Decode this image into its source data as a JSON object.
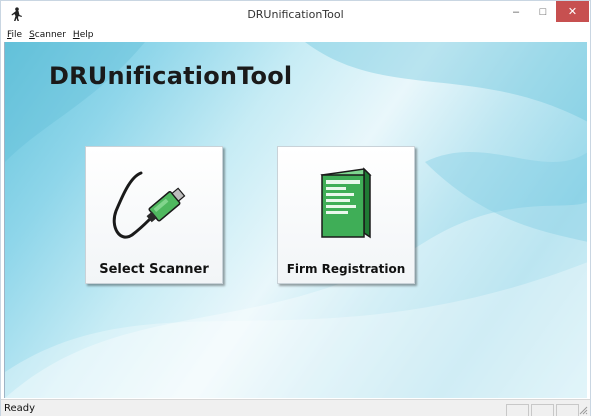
{
  "window": {
    "title": "DRUnificationTool",
    "app_icon": "app-figure-icon",
    "controls": {
      "minimize": "–",
      "maximize": "□",
      "close": "✕"
    }
  },
  "menu": {
    "items": [
      {
        "label": "File",
        "mnemonic": "F",
        "rest": "ile"
      },
      {
        "label": "Scanner",
        "mnemonic": "S",
        "rest": "canner"
      },
      {
        "label": "Help",
        "mnemonic": "H",
        "rest": "elp"
      }
    ]
  },
  "main": {
    "heading": "DRUnificationTool",
    "tiles": [
      {
        "label": "Select Scanner",
        "icon": "usb-cable-icon"
      },
      {
        "label": "Firm Registration",
        "icon": "firmware-box-icon"
      }
    ]
  },
  "status": {
    "text": "Ready"
  },
  "colors": {
    "close_button": "#c75050",
    "client_bg": "#8fd6ea",
    "usb_plug": "#3a9a4a",
    "firm_box": "#2e9e4a"
  }
}
